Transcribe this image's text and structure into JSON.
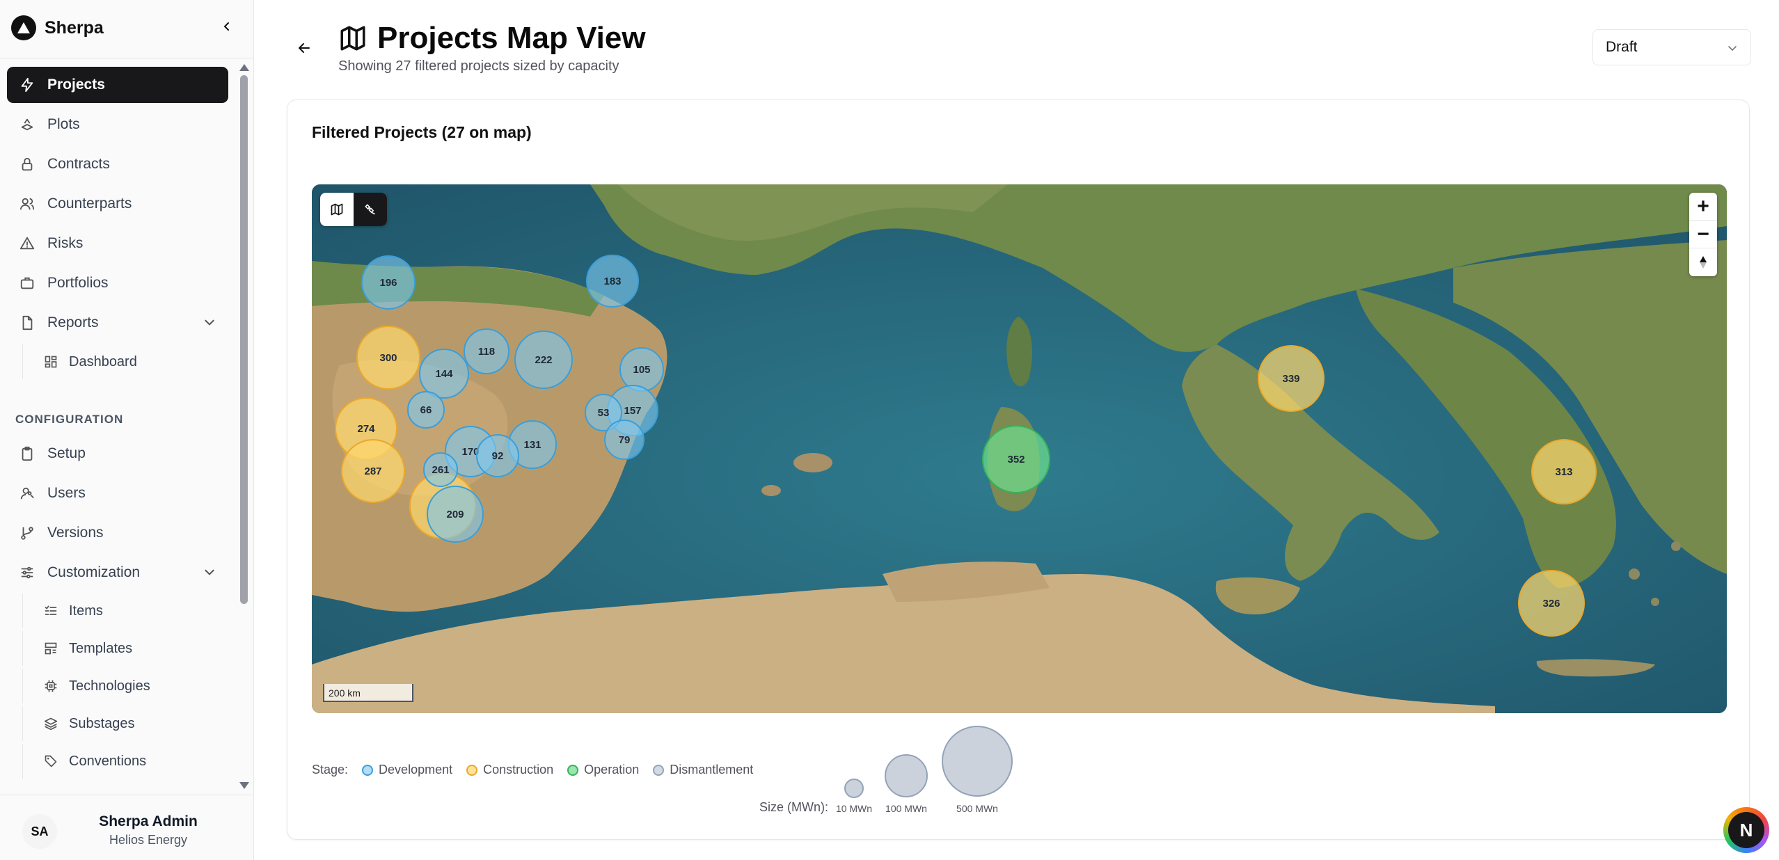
{
  "brand": {
    "name": "Sherpa"
  },
  "nav": {
    "main": [
      {
        "label": "Projects",
        "icon": "zap-icon",
        "active": true
      },
      {
        "label": "Plots",
        "icon": "plots-icon"
      },
      {
        "label": "Contracts",
        "icon": "lock-icon"
      },
      {
        "label": "Counterparts",
        "icon": "users-icon"
      },
      {
        "label": "Risks",
        "icon": "warning-icon"
      },
      {
        "label": "Portfolios",
        "icon": "briefcase-icon"
      },
      {
        "label": "Reports",
        "icon": "file-icon",
        "expanded": true
      }
    ],
    "reports_sub": [
      {
        "label": "Dashboard",
        "icon": "dashboard-icon"
      }
    ],
    "config_label": "CONFIGURATION",
    "config": [
      {
        "label": "Setup",
        "icon": "clipboard-icon"
      },
      {
        "label": "Users",
        "icon": "user-key-icon"
      },
      {
        "label": "Versions",
        "icon": "git-branch-icon"
      },
      {
        "label": "Customization",
        "icon": "sliders-icon",
        "expanded": true
      }
    ],
    "custom_sub": [
      {
        "label": "Items",
        "icon": "list-check-icon"
      },
      {
        "label": "Templates",
        "icon": "template-icon"
      },
      {
        "label": "Technologies",
        "icon": "cpu-icon"
      },
      {
        "label": "Substages",
        "icon": "layers-icon"
      },
      {
        "label": "Conventions",
        "icon": "tag-icon"
      }
    ]
  },
  "user": {
    "initials": "SA",
    "name": "Sherpa Admin",
    "org": "Helios Energy"
  },
  "header": {
    "title": "Projects Map View",
    "subtitle": "Showing 27 filtered projects sized by capacity",
    "version": "Draft"
  },
  "card": {
    "title": "Filtered Projects (27 on map)"
  },
  "map": {
    "scale_label": "200 km",
    "zoom_in": "+",
    "zoom_out": "−",
    "stage_colors": {
      "Development": "#3b9ed8",
      "Construction": "#eba82a",
      "Operation": "#33b35a",
      "Dismantlement": "#94a3b8"
    },
    "projects": [
      {
        "value": "196",
        "stage": "Development"
      },
      {
        "value": "183",
        "stage": "Development"
      },
      {
        "value": "105",
        "stage": "Development"
      },
      {
        "value": "300",
        "stage": "Construction"
      },
      {
        "value": "222",
        "stage": "Development"
      },
      {
        "value": "118",
        "stage": "Development"
      },
      {
        "value": "144",
        "stage": "Development"
      },
      {
        "value": "157",
        "stage": "Development"
      },
      {
        "value": "66",
        "stage": "Development"
      },
      {
        "value": "53",
        "stage": "Development"
      },
      {
        "value": "79",
        "stage": "Development"
      },
      {
        "value": "274",
        "stage": "Construction"
      },
      {
        "value": "131",
        "stage": "Development"
      },
      {
        "value": "170",
        "stage": "Development"
      },
      {
        "value": "261",
        "stage": "Development"
      },
      {
        "value": "92",
        "stage": "Development"
      },
      {
        "value": "287",
        "stage": "Construction"
      },
      {
        "value": "209",
        "stage": "Development"
      },
      {
        "value": "339",
        "stage": "Construction"
      },
      {
        "value": "352",
        "stage": "Operation"
      },
      {
        "value": "313",
        "stage": "Construction"
      },
      {
        "value": "326",
        "stage": "Construction"
      }
    ]
  },
  "legend": {
    "stage_label": "Stage:",
    "stages": [
      "Development",
      "Construction",
      "Operation",
      "Dismantlement"
    ],
    "size_label": "Size (MWn):",
    "sizes": [
      "10 MWn",
      "100 MWn",
      "500 MWn"
    ]
  },
  "assistant_badge": "N"
}
